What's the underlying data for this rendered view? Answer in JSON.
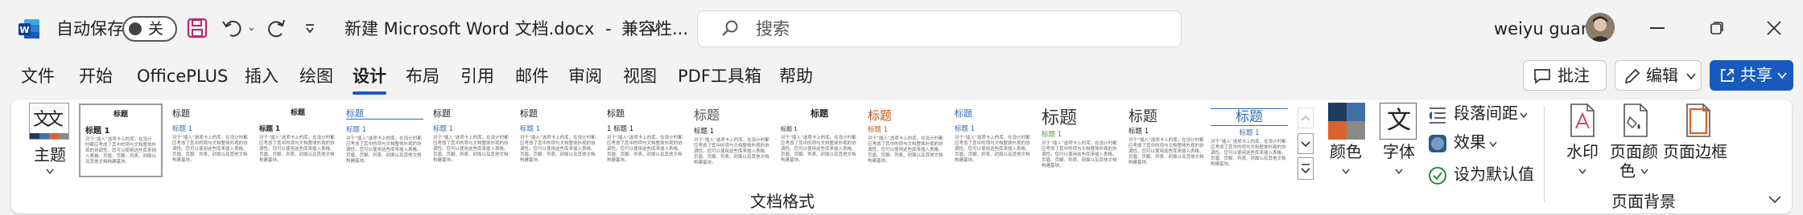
{
  "titlebar": {
    "app_icon": "word-icon",
    "autosave_label": "自动保存",
    "autosave_state": "关",
    "doc_title": "新建 Microsoft Word 文档.docx",
    "compat_label": "兼容性...",
    "search_placeholder": "搜索",
    "user_name": "weiyu guan"
  },
  "tabs": [
    {
      "label": "文件"
    },
    {
      "label": "开始"
    },
    {
      "label": "OfficePLUS"
    },
    {
      "label": "插入"
    },
    {
      "label": "绘图"
    },
    {
      "label": "设计"
    },
    {
      "label": "布局"
    },
    {
      "label": "引用"
    },
    {
      "label": "邮件"
    },
    {
      "label": "审阅"
    },
    {
      "label": "视图"
    },
    {
      "label": "PDF工具箱"
    },
    {
      "label": "帮助"
    }
  ],
  "actions": {
    "comments": "批注",
    "edit": "编辑",
    "share": "共享"
  },
  "ribbon": {
    "theme_label": "主题",
    "theme_icon_text": "文文",
    "styles": [
      {
        "title": "标题",
        "heading": "标题 1"
      },
      {
        "title": "标题",
        "heading": "标题 1"
      },
      {
        "title": "标题",
        "heading": "标题 1"
      },
      {
        "title": "标题",
        "heading": "标题 1"
      },
      {
        "title": "标题",
        "heading": "标题 1"
      },
      {
        "title": "标题",
        "heading": "标题 1"
      },
      {
        "title": "标题",
        "heading": "1 标题 1"
      },
      {
        "title": "标题",
        "heading": "标题 1"
      },
      {
        "title": "标题",
        "heading": "标题 1"
      },
      {
        "title": "标题",
        "heading": "标题 1"
      },
      {
        "title": "标题",
        "heading": "标题 1"
      },
      {
        "title": "标题",
        "heading": "标题 1"
      },
      {
        "title": "标题",
        "heading": "标题 1"
      },
      {
        "title": "标题",
        "heading": "标题 1"
      }
    ],
    "style_body": "对于“插入”选项卡上的库，在设计时都应考虑了其中的项与文档整体外观的协调性。您可以使用这些库来插入表格、页眉、页脚、列表、封面以及其他文档构建基块。",
    "colors_label": "颜色",
    "fonts_label": "字体",
    "fonts_icon_text": "文",
    "paragraph_spacing": "段落间距",
    "effects": "效果",
    "set_default": "设为默认值",
    "watermark": "水印",
    "page_color": "页面颜色",
    "page_color_line1": "页面颜",
    "page_color_line2": "色",
    "page_borders": "页面边框",
    "group_doc_format": "文档格式",
    "group_page_bg": "页面背景"
  },
  "colors": {
    "accent": "#185abd",
    "share_bg": "#185abd",
    "palette": [
      "#1f3b5e",
      "#3f6fa5",
      "#d9632f",
      "#8a8a8a"
    ]
  }
}
